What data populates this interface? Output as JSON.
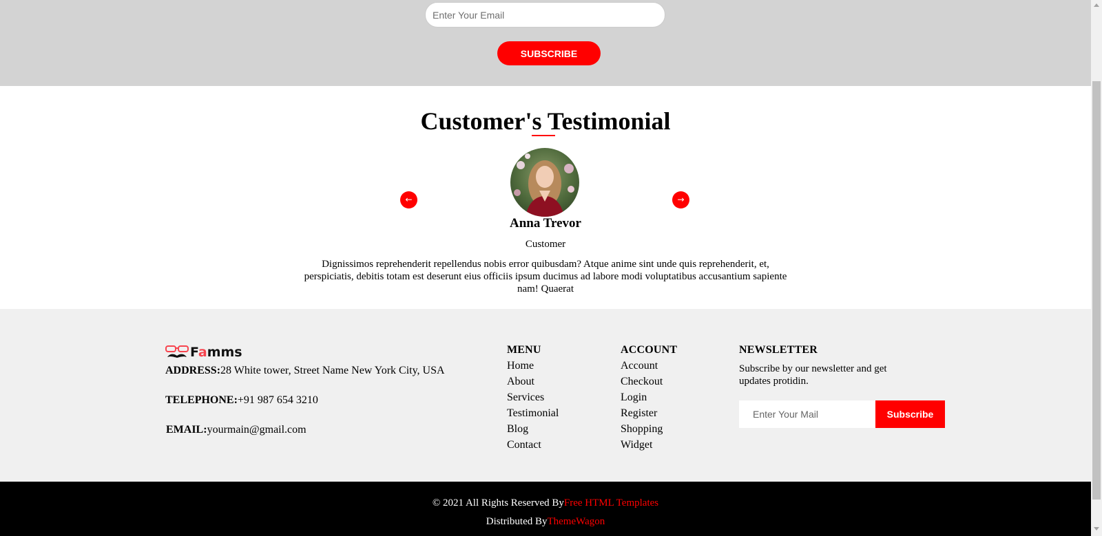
{
  "subscribe": {
    "email_placeholder": "Enter Your Email",
    "button_label": "SUBSCRIBE"
  },
  "testimonial": {
    "title": "Customer's Testimonial",
    "prev_arrow": "←",
    "next_arrow": "→",
    "name": "Anna Trevor",
    "role": "Customer",
    "quote": "Dignissimos reprehenderit repellendus nobis error quibusdam? Atque anime sint unde quis reprehenderit, et, perspiciatis, debitis totam est deserunt eius officiis ipsum ducimus ad labore modi voluptatibus accusantium sapiente nam! Quaerat"
  },
  "footer": {
    "logo": {
      "prefix": "F",
      "accent": "a",
      "suffix": "mms"
    },
    "address_label": "ADDRESS:",
    "address_value": "28 White tower, Street Name New York City, USA",
    "telephone_label": "TELEPHONE:",
    "telephone_value": "+91 987 654 3210",
    "email_label": "EMAIL:",
    "email_value": "yourmain@gmail.com",
    "menu": {
      "title": "MENU",
      "items": [
        "Home",
        "About",
        "Services",
        "Testimonial",
        "Blog",
        "Contact"
      ]
    },
    "account": {
      "title": "ACCOUNT",
      "items": [
        "Account",
        "Checkout",
        "Login",
        "Register",
        "Shopping",
        "Widget"
      ]
    },
    "newsletter": {
      "title": "NEWSLETTER",
      "text": "Subscribe by our newsletter and get updates protidin.",
      "input_placeholder": "Enter Your Mail",
      "button_label": "Subscribe"
    }
  },
  "copyright": {
    "line1_prefix": "© 2021 All Rights Reserved By",
    "line1_link": "Free HTML Templates",
    "line2_prefix": "Distributed By",
    "line2_link": "ThemeWagon"
  },
  "colors": {
    "accent": "#ff0000",
    "subscribe_band": "#d3d3d3",
    "footer_bg": "#f0f0f0",
    "copyright_bg": "#000000"
  }
}
